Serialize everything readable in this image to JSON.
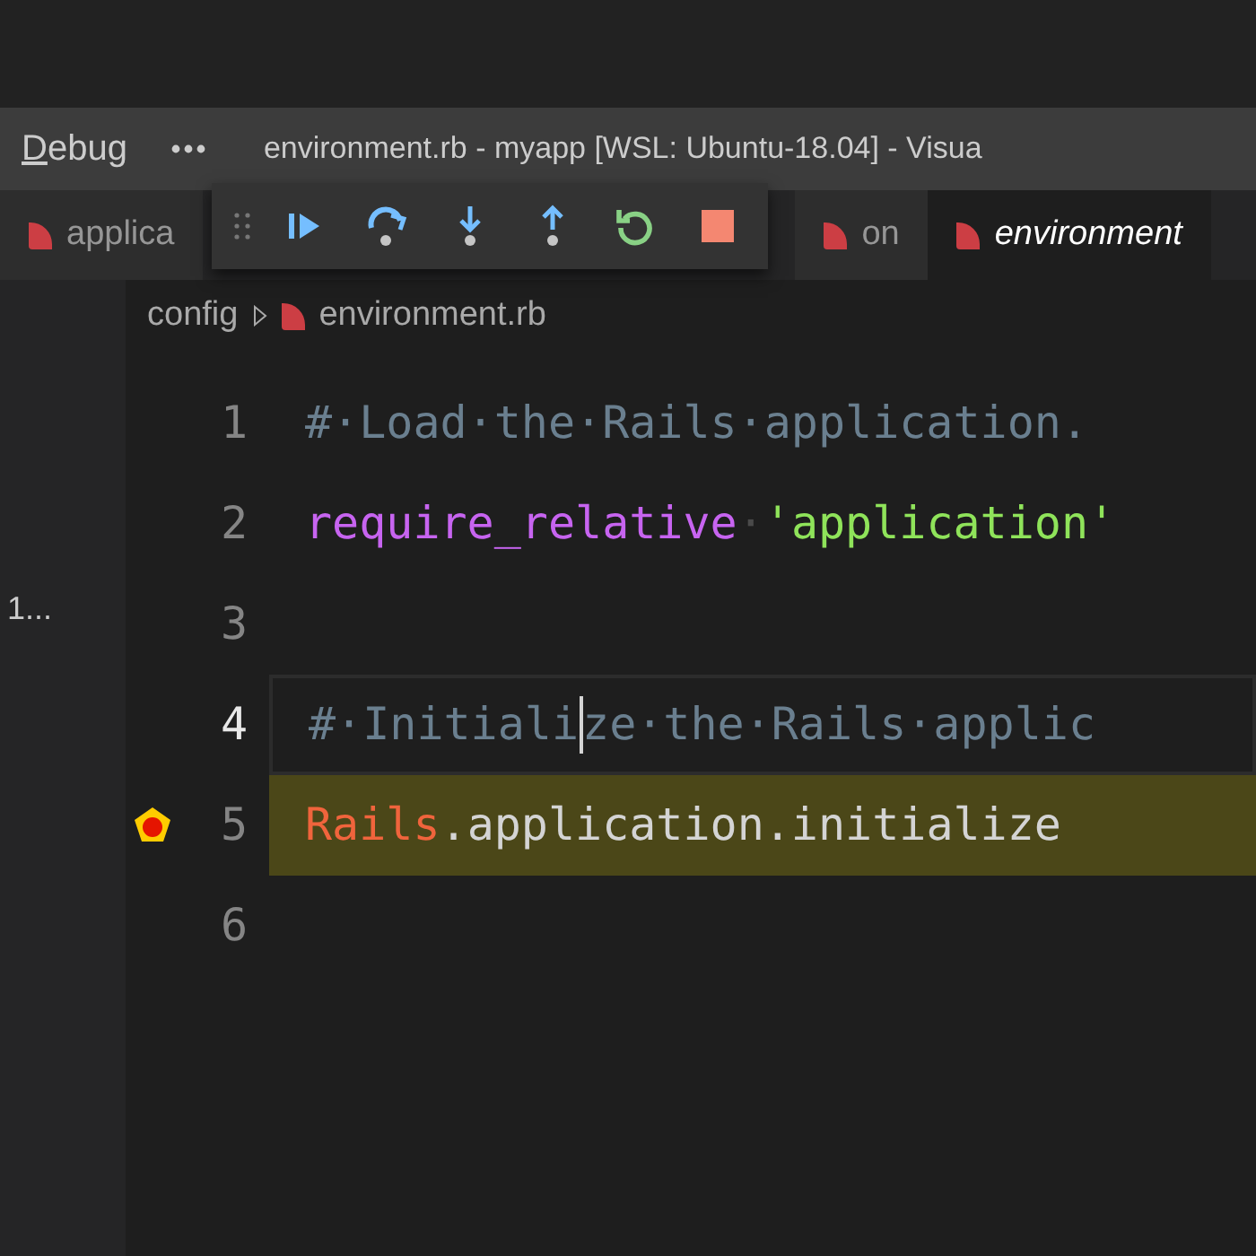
{
  "title_bar": {
    "menu": [
      {
        "label": "Debug"
      }
    ],
    "title": "environment.rb - myapp [WSL: Ubuntu-18.04] - Visua"
  },
  "debug_toolbar": {
    "buttons": [
      {
        "kind": "continue"
      },
      {
        "kind": "step_over"
      },
      {
        "kind": "step_into"
      },
      {
        "kind": "step_out"
      },
      {
        "kind": "restart"
      },
      {
        "kind": "stop"
      }
    ]
  },
  "tabs": [
    {
      "label": "applica",
      "selected": false,
      "preview": false
    },
    {
      "label": "on",
      "selected": false,
      "preview": false
    },
    {
      "label": "environment",
      "selected": true,
      "preview": true
    }
  ],
  "sidebar": {
    "items": [
      "1..."
    ]
  },
  "breadcrumb": [
    "config",
    "environment.rb"
  ],
  "editor": {
    "lines": [
      {
        "number": "1",
        "active": false,
        "stopped": false,
        "breakpoint": false,
        "tokens": [
          {
            "kind": "comment",
            "text": "#·Load·the·Rails·application."
          }
        ]
      },
      {
        "number": "2",
        "active": false,
        "stopped": false,
        "breakpoint": false,
        "tokens": [
          {
            "kind": "keyword",
            "text": "require_relative"
          },
          {
            "kind": "whitespace",
            "text": "·"
          },
          {
            "kind": "string",
            "text": "'application'"
          }
        ]
      },
      {
        "number": "3",
        "active": false,
        "stopped": false,
        "breakpoint": false
      },
      {
        "number": "4",
        "active": true,
        "stopped": false,
        "breakpoint": false,
        "tokens": [
          {
            "kind": "comment",
            "text": "#·Initiali"
          },
          {
            "kind": "cursor"
          },
          {
            "kind": "comment",
            "text": "ze·the·Rails·applic"
          }
        ]
      },
      {
        "number": "5",
        "active": false,
        "stopped": true,
        "breakpoint": true,
        "tokens": [
          {
            "kind": "class",
            "text": "Rails"
          },
          {
            "kind": "plain",
            "text": ".application.initialize"
          }
        ]
      },
      {
        "number": "6",
        "active": false,
        "stopped": false,
        "breakpoint": false
      }
    ]
  }
}
